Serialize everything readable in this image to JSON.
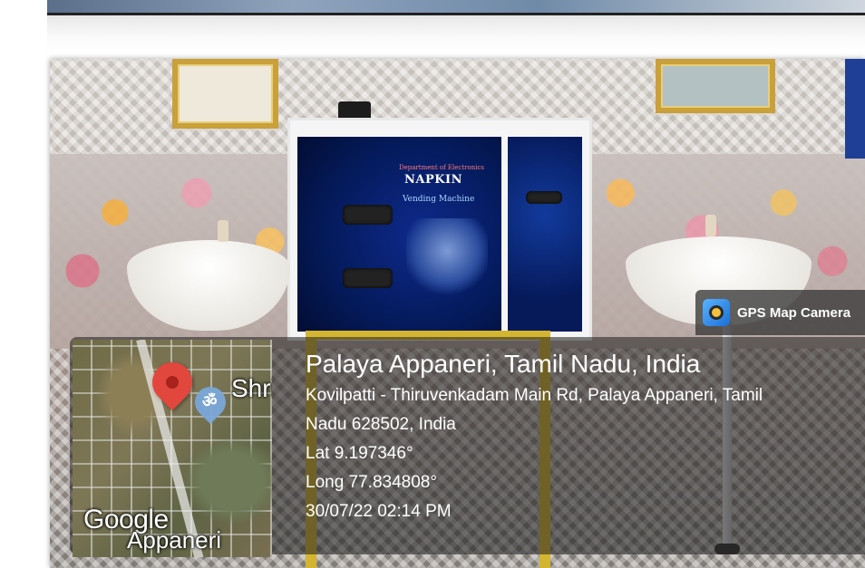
{
  "gps_badge": {
    "icon": "camera-lens-icon",
    "label": "GPS Map Camera"
  },
  "map": {
    "label_top": "Shri",
    "watermark": "Google",
    "label_bottom": "Appaneri",
    "om_symbol": "ॐ"
  },
  "location": {
    "title": "Palaya Appaneri, Tamil Nadu, India",
    "address_line1": "Kovilpatti - Thiruvenkadam Main Rd, Palaya Appaneri, Tamil",
    "address_line2": "Nadu 628502, India",
    "lat": "Lat 9.197346°",
    "long": "Long 77.834808°",
    "datetime": "30/07/22 02:14 PM"
  },
  "poster": {
    "department": "Department of Electronics",
    "title": "NAPKIN",
    "subtitle": "Vending Machine"
  },
  "colors": {
    "pin_red": "#e2473d",
    "stand_yellow": "#d4b531",
    "machine_blue": "#041a5a"
  }
}
